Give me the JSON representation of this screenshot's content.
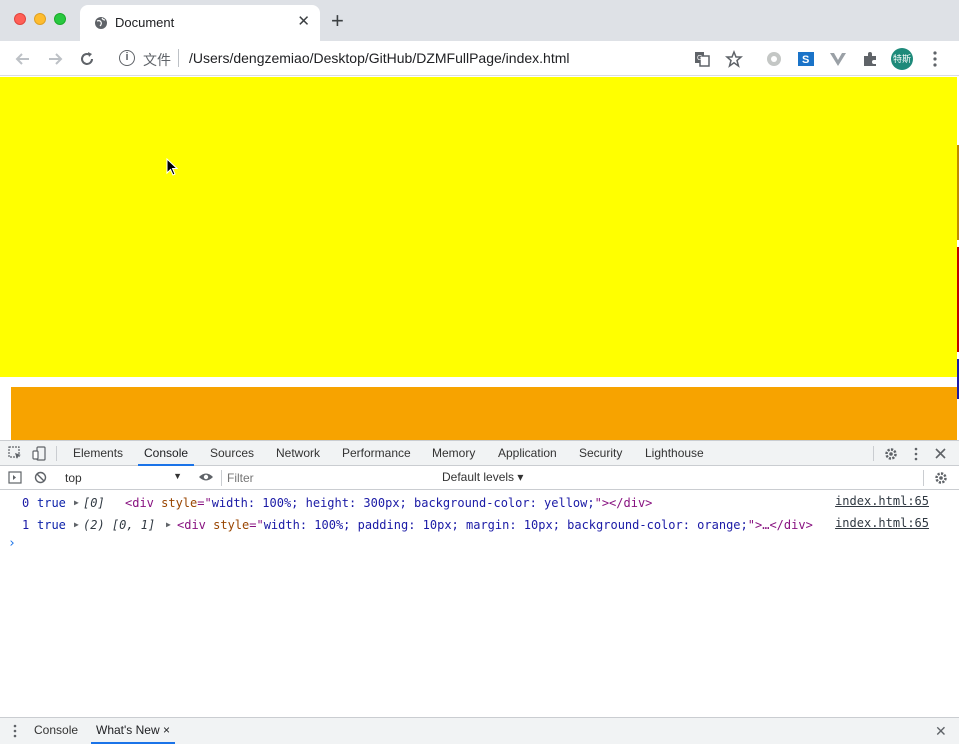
{
  "browser": {
    "tab_title": "Document",
    "tab_close": "✕",
    "new_tab": "+",
    "url_scheme": "文件",
    "url": "/Users/dengzemiao/Desktop/GitHub/DZMFullPage/index.html",
    "avatar_text": "特斯"
  },
  "page": {
    "yellow_color": "#ffff00",
    "orange_color": "#f7a300"
  },
  "devtools": {
    "tabs": [
      "Elements",
      "Console",
      "Sources",
      "Network",
      "Performance",
      "Memory",
      "Application",
      "Security",
      "Lighthouse"
    ],
    "active_tab": "Console",
    "context": "top",
    "filter_placeholder": "Filter",
    "levels": "Default levels ▾",
    "logs": [
      {
        "index": "0",
        "bool": "true",
        "array": "[0]",
        "tag_open": "<div ",
        "attr": "style",
        "eq": "=\"",
        "value": "width: 100%; height: 300px; background-color: yellow;",
        "tag_close": "\"></div>",
        "source": "index.html:65"
      },
      {
        "index": "1",
        "bool": "true",
        "array": "(2) [0, 1]",
        "tag_open": "<div ",
        "attr": "style",
        "eq": "=\"",
        "value": "width: 100%; padding: 10px; margin: 10px; background-color: orange;",
        "tag_close": "\">…</div>",
        "source": "index.html:65"
      }
    ],
    "prompt": "›",
    "drawer_tabs": [
      "Console",
      "What's New"
    ],
    "drawer_active": "What's New",
    "drawer_tab_close": "×",
    "drawer_close": "✕"
  }
}
